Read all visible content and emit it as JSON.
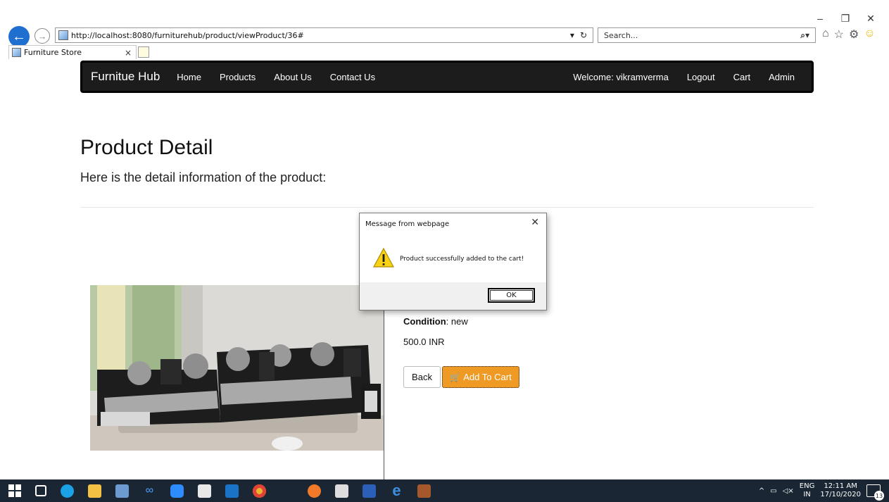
{
  "browser": {
    "url": "http://localhost:8080/furniturehub/product/viewProduct/36#",
    "search_placeholder": "Search...",
    "tab_title": "Furniture Store",
    "tab_close": "×",
    "window_controls": {
      "minimize": "–",
      "restore": "❐",
      "close": "✕"
    },
    "addr_tools": {
      "dropdown": "▾",
      "refresh": "ᶜ"
    },
    "search_icon": "⌕▾",
    "icons": {
      "home": "⌂",
      "favorites": "☆",
      "settings": "⚙",
      "feedback": "☺"
    }
  },
  "navbar": {
    "brand": "Furnitue Hub",
    "links": [
      "Home",
      "Products",
      "About Us",
      "Contact Us"
    ],
    "welcome": "Welcome: vikramverma",
    "right_links": [
      "Logout",
      "Cart",
      "Admin"
    ]
  },
  "page": {
    "title": "Product Detail",
    "subtitle": "Here is the detail information of the product:"
  },
  "product": {
    "condition_label": "Condition",
    "condition_value": ": new",
    "price": "500.0 INR",
    "back_label": "Back",
    "add_to_cart_label": "Add To Cart",
    "cart_icon": "🛒"
  },
  "dialog": {
    "title": "Message from webpage",
    "close": "✕",
    "message": "Product successfully added to the cart!",
    "ok_label": "OK"
  },
  "taskbar": {
    "tray_caret": "^",
    "lang_line1": "ENG",
    "lang_line2": "IN",
    "time": "12:11 AM",
    "date": "17/10/2020",
    "notification_count": "13"
  },
  "colors": {
    "navbar_bg": "#1c1c1c",
    "add_cart_bg": "#ee9a24",
    "taskbar_bg": "#1a2633",
    "back_arrow": "#1f6fd1"
  }
}
